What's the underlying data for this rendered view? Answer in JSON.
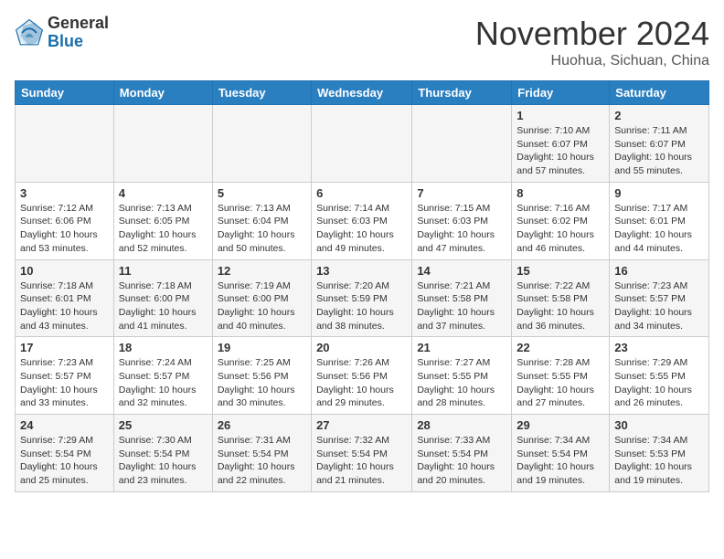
{
  "header": {
    "logo_general": "General",
    "logo_blue": "Blue",
    "month_title": "November 2024",
    "location": "Huohua, Sichuan, China"
  },
  "days_of_week": [
    "Sunday",
    "Monday",
    "Tuesday",
    "Wednesday",
    "Thursday",
    "Friday",
    "Saturday"
  ],
  "weeks": [
    [
      {
        "day": "",
        "info": ""
      },
      {
        "day": "",
        "info": ""
      },
      {
        "day": "",
        "info": ""
      },
      {
        "day": "",
        "info": ""
      },
      {
        "day": "",
        "info": ""
      },
      {
        "day": "1",
        "info": "Sunrise: 7:10 AM\nSunset: 6:07 PM\nDaylight: 10 hours and 57 minutes."
      },
      {
        "day": "2",
        "info": "Sunrise: 7:11 AM\nSunset: 6:07 PM\nDaylight: 10 hours and 55 minutes."
      }
    ],
    [
      {
        "day": "3",
        "info": "Sunrise: 7:12 AM\nSunset: 6:06 PM\nDaylight: 10 hours and 53 minutes."
      },
      {
        "day": "4",
        "info": "Sunrise: 7:13 AM\nSunset: 6:05 PM\nDaylight: 10 hours and 52 minutes."
      },
      {
        "day": "5",
        "info": "Sunrise: 7:13 AM\nSunset: 6:04 PM\nDaylight: 10 hours and 50 minutes."
      },
      {
        "day": "6",
        "info": "Sunrise: 7:14 AM\nSunset: 6:03 PM\nDaylight: 10 hours and 49 minutes."
      },
      {
        "day": "7",
        "info": "Sunrise: 7:15 AM\nSunset: 6:03 PM\nDaylight: 10 hours and 47 minutes."
      },
      {
        "day": "8",
        "info": "Sunrise: 7:16 AM\nSunset: 6:02 PM\nDaylight: 10 hours and 46 minutes."
      },
      {
        "day": "9",
        "info": "Sunrise: 7:17 AM\nSunset: 6:01 PM\nDaylight: 10 hours and 44 minutes."
      }
    ],
    [
      {
        "day": "10",
        "info": "Sunrise: 7:18 AM\nSunset: 6:01 PM\nDaylight: 10 hours and 43 minutes."
      },
      {
        "day": "11",
        "info": "Sunrise: 7:18 AM\nSunset: 6:00 PM\nDaylight: 10 hours and 41 minutes."
      },
      {
        "day": "12",
        "info": "Sunrise: 7:19 AM\nSunset: 6:00 PM\nDaylight: 10 hours and 40 minutes."
      },
      {
        "day": "13",
        "info": "Sunrise: 7:20 AM\nSunset: 5:59 PM\nDaylight: 10 hours and 38 minutes."
      },
      {
        "day": "14",
        "info": "Sunrise: 7:21 AM\nSunset: 5:58 PM\nDaylight: 10 hours and 37 minutes."
      },
      {
        "day": "15",
        "info": "Sunrise: 7:22 AM\nSunset: 5:58 PM\nDaylight: 10 hours and 36 minutes."
      },
      {
        "day": "16",
        "info": "Sunrise: 7:23 AM\nSunset: 5:57 PM\nDaylight: 10 hours and 34 minutes."
      }
    ],
    [
      {
        "day": "17",
        "info": "Sunrise: 7:23 AM\nSunset: 5:57 PM\nDaylight: 10 hours and 33 minutes."
      },
      {
        "day": "18",
        "info": "Sunrise: 7:24 AM\nSunset: 5:57 PM\nDaylight: 10 hours and 32 minutes."
      },
      {
        "day": "19",
        "info": "Sunrise: 7:25 AM\nSunset: 5:56 PM\nDaylight: 10 hours and 30 minutes."
      },
      {
        "day": "20",
        "info": "Sunrise: 7:26 AM\nSunset: 5:56 PM\nDaylight: 10 hours and 29 minutes."
      },
      {
        "day": "21",
        "info": "Sunrise: 7:27 AM\nSunset: 5:55 PM\nDaylight: 10 hours and 28 minutes."
      },
      {
        "day": "22",
        "info": "Sunrise: 7:28 AM\nSunset: 5:55 PM\nDaylight: 10 hours and 27 minutes."
      },
      {
        "day": "23",
        "info": "Sunrise: 7:29 AM\nSunset: 5:55 PM\nDaylight: 10 hours and 26 minutes."
      }
    ],
    [
      {
        "day": "24",
        "info": "Sunrise: 7:29 AM\nSunset: 5:54 PM\nDaylight: 10 hours and 25 minutes."
      },
      {
        "day": "25",
        "info": "Sunrise: 7:30 AM\nSunset: 5:54 PM\nDaylight: 10 hours and 23 minutes."
      },
      {
        "day": "26",
        "info": "Sunrise: 7:31 AM\nSunset: 5:54 PM\nDaylight: 10 hours and 22 minutes."
      },
      {
        "day": "27",
        "info": "Sunrise: 7:32 AM\nSunset: 5:54 PM\nDaylight: 10 hours and 21 minutes."
      },
      {
        "day": "28",
        "info": "Sunrise: 7:33 AM\nSunset: 5:54 PM\nDaylight: 10 hours and 20 minutes."
      },
      {
        "day": "29",
        "info": "Sunrise: 7:34 AM\nSunset: 5:54 PM\nDaylight: 10 hours and 19 minutes."
      },
      {
        "day": "30",
        "info": "Sunrise: 7:34 AM\nSunset: 5:53 PM\nDaylight: 10 hours and 19 minutes."
      }
    ]
  ]
}
